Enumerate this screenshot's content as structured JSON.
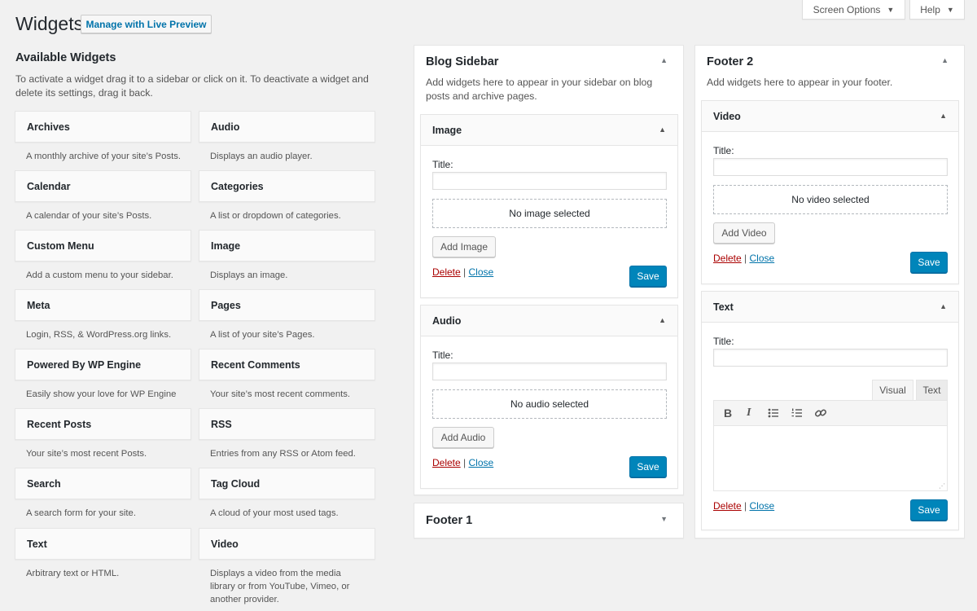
{
  "header": {
    "title": "Widgets",
    "live_preview": "Manage with Live Preview",
    "screen_options": "Screen Options",
    "help": "Help"
  },
  "available": {
    "title": "Available Widgets",
    "description": "To activate a widget drag it to a sidebar or click on it. To deactivate a widget and delete its settings, drag it back.",
    "widgets": [
      {
        "name": "Archives",
        "desc": "A monthly archive of your site’s Posts."
      },
      {
        "name": "Audio",
        "desc": "Displays an audio player."
      },
      {
        "name": "Calendar",
        "desc": "A calendar of your site’s Posts."
      },
      {
        "name": "Categories",
        "desc": "A list or dropdown of categories."
      },
      {
        "name": "Custom Menu",
        "desc": "Add a custom menu to your sidebar."
      },
      {
        "name": "Image",
        "desc": "Displays an image."
      },
      {
        "name": "Meta",
        "desc": "Login, RSS, & WordPress.org links."
      },
      {
        "name": "Pages",
        "desc": "A list of your site’s Pages."
      },
      {
        "name": "Powered By WP Engine",
        "desc": "Easily show your love for WP Engine"
      },
      {
        "name": "Recent Comments",
        "desc": "Your site’s most recent comments."
      },
      {
        "name": "Recent Posts",
        "desc": "Your site’s most recent Posts."
      },
      {
        "name": "RSS",
        "desc": "Entries from any RSS or Atom feed."
      },
      {
        "name": "Search",
        "desc": "A search form for your site."
      },
      {
        "name": "Tag Cloud",
        "desc": "A cloud of your most used tags."
      },
      {
        "name": "Text",
        "desc": "Arbitrary text or HTML."
      },
      {
        "name": "Video",
        "desc": "Displays a video from the media library or from YouTube, Vimeo, or another provider."
      }
    ]
  },
  "blog_sidebar": {
    "title": "Blog Sidebar",
    "description": "Add widgets here to appear in your sidebar on blog posts and archive pages.",
    "image_widget": {
      "name": "Image",
      "title_label": "Title:",
      "title_value": "",
      "placeholder": "No image selected",
      "add_button": "Add Image",
      "delete": "Delete",
      "separator": "|",
      "close": "Close",
      "save": "Save"
    },
    "audio_widget": {
      "name": "Audio",
      "title_label": "Title:",
      "title_value": "",
      "placeholder": "No audio selected",
      "add_button": "Add Audio",
      "delete": "Delete",
      "separator": "|",
      "close": "Close",
      "save": "Save"
    }
  },
  "footer1": {
    "title": "Footer 1"
  },
  "footer2": {
    "title": "Footer 2",
    "description": "Add widgets here to appear in your footer.",
    "video_widget": {
      "name": "Video",
      "title_label": "Title:",
      "title_value": "",
      "placeholder": "No video selected",
      "add_button": "Add Video",
      "delete": "Delete",
      "separator": "|",
      "close": "Close",
      "save": "Save"
    },
    "text_widget": {
      "name": "Text",
      "title_label": "Title:",
      "title_value": "",
      "tab_visual": "Visual",
      "tab_text": "Text",
      "tools": {
        "bold": "B",
        "italic": "I",
        "bullet_list_icon": "bullet-list-icon",
        "numbered_list_icon": "numbered-list-icon",
        "link_icon": "link-icon"
      },
      "delete": "Delete",
      "separator": "|",
      "close": "Close",
      "save": "Save"
    }
  },
  "colors": {
    "background": "#f1f1f1",
    "link": "#0073aa",
    "delete": "#aa0000",
    "primary_button": "#0085ba"
  }
}
